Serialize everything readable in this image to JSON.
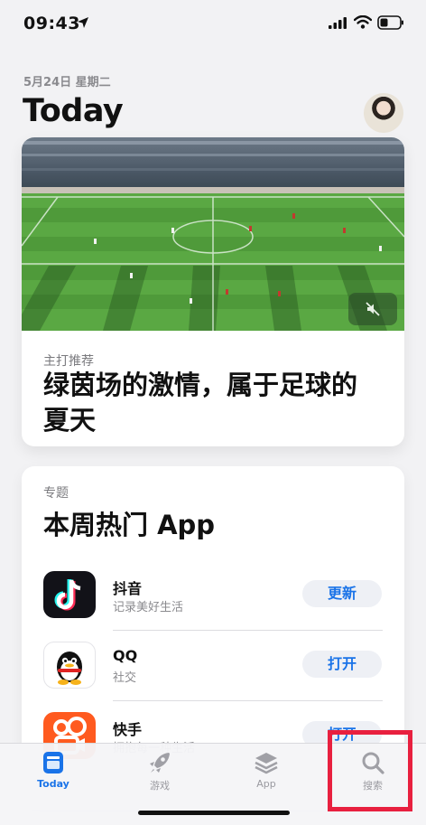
{
  "status_bar": {
    "time": "09:43"
  },
  "header": {
    "date": "5月24日 星期二",
    "title": "Today"
  },
  "feature_card": {
    "eyebrow": "主打推荐",
    "title": "绿茵场的激情，属于足球的夏天"
  },
  "list_card": {
    "eyebrow": "专题",
    "title": "本周热门 App",
    "apps": [
      {
        "name": "抖音",
        "subtitle": "记录美好生活",
        "button": "更新",
        "icon": "douyin-icon"
      },
      {
        "name": "QQ",
        "subtitle": "社交",
        "button": "打开",
        "icon": "qq-icon"
      },
      {
        "name": "快手",
        "subtitle": "拥抱每一种生活",
        "button": "打开",
        "icon": "kuaishou-icon"
      }
    ]
  },
  "tab_bar": {
    "tabs": [
      {
        "label": "Today",
        "icon": "today-icon",
        "active": true
      },
      {
        "label": "游戏",
        "icon": "rocket-icon",
        "active": false
      },
      {
        "label": "App",
        "icon": "layers-icon",
        "active": false
      },
      {
        "label": "搜索",
        "icon": "search-icon",
        "active": false
      }
    ]
  },
  "colors": {
    "accent": "#1a73e8",
    "highlight": "#e8203f"
  }
}
